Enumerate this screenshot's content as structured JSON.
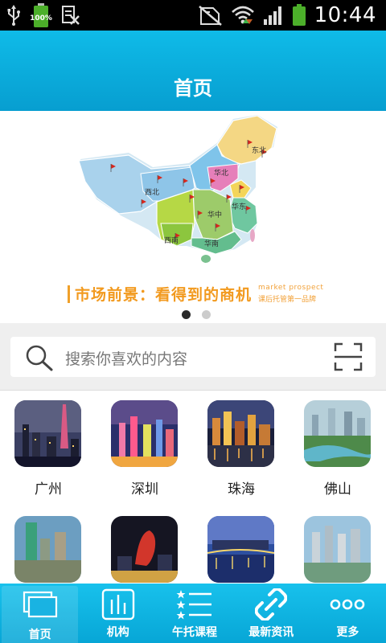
{
  "status_bar": {
    "time": "10:44",
    "battery_small_label": "100%",
    "battery_small_level": 1.0,
    "battery_level": 1.0
  },
  "header": {
    "title": "首页"
  },
  "banner": {
    "tagline": "市场前景：看得到的商机",
    "tagline_en": "market prospect",
    "tagline_sub": "课后托管第一品牌",
    "region_labels": [
      "东北",
      "华北",
      "西北",
      "华东",
      "华中",
      "西南",
      "华南"
    ],
    "slide_count": 2,
    "active_slide": 1
  },
  "search": {
    "placeholder": "搜索你喜欢的内容"
  },
  "cities": [
    {
      "name": "广州"
    },
    {
      "name": "深圳"
    },
    {
      "name": "珠海"
    },
    {
      "name": "佛山"
    },
    {
      "name": ""
    },
    {
      "name": ""
    },
    {
      "name": ""
    },
    {
      "name": ""
    }
  ],
  "nav": [
    {
      "label": "首页",
      "icon": "home-windows-icon",
      "active": true
    },
    {
      "label": "机构",
      "icon": "chart-bars-icon",
      "active": false
    },
    {
      "label": "午托课程",
      "icon": "star-list-icon",
      "active": false
    },
    {
      "label": "最新资讯",
      "icon": "chain-link-icon",
      "active": false
    },
    {
      "label": "更多",
      "icon": "more-dots-icon",
      "active": false
    }
  ],
  "colors": {
    "header_blue": "#079ed0",
    "nav_blue": "#07a6d6",
    "tagline_orange": "#f29a1f",
    "battery_green": "#4caf2a"
  }
}
